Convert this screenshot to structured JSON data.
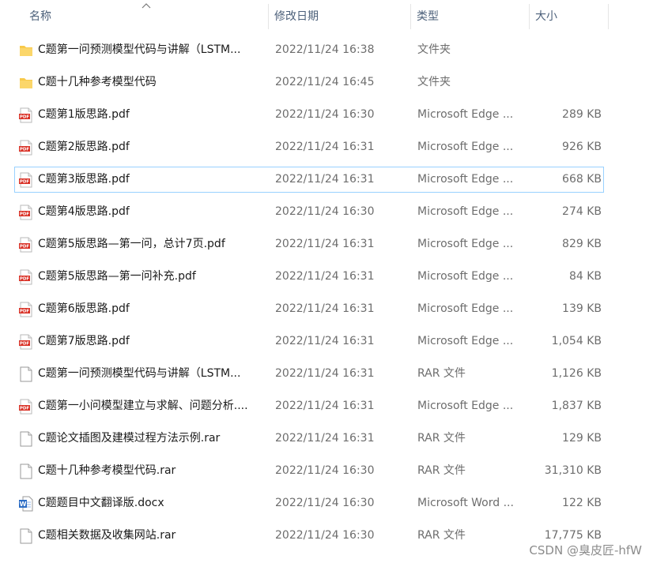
{
  "header": {
    "name_label": "名称",
    "date_label": "修改日期",
    "type_label": "类型",
    "size_label": "大小"
  },
  "files": [
    {
      "icon": "folder-icon",
      "name": "C题第一问预测模型代码与讲解（LSTM...",
      "date": "2022/11/24 16:38",
      "type": "文件夹",
      "size": ""
    },
    {
      "icon": "folder-icon",
      "name": "C题十几种参考模型代码",
      "date": "2022/11/24 16:45",
      "type": "文件夹",
      "size": ""
    },
    {
      "icon": "pdf-icon",
      "name": "C题第1版思路.pdf",
      "date": "2022/11/24 16:30",
      "type": "Microsoft Edge ...",
      "size": "289 KB"
    },
    {
      "icon": "pdf-icon",
      "name": "C题第2版思路.pdf",
      "date": "2022/11/24 16:31",
      "type": "Microsoft Edge ...",
      "size": "926 KB"
    },
    {
      "icon": "pdf-icon",
      "name": "C题第3版思路.pdf",
      "date": "2022/11/24 16:31",
      "type": "Microsoft Edge ...",
      "size": "668 KB"
    },
    {
      "icon": "pdf-icon",
      "name": "C题第4版思路.pdf",
      "date": "2022/11/24 16:30",
      "type": "Microsoft Edge ...",
      "size": "274 KB"
    },
    {
      "icon": "pdf-icon",
      "name": "C题第5版思路—第一问，总计7页.pdf",
      "date": "2022/11/24 16:31",
      "type": "Microsoft Edge ...",
      "size": "829 KB"
    },
    {
      "icon": "pdf-icon",
      "name": "C题第5版思路—第一问补充.pdf",
      "date": "2022/11/24 16:31",
      "type": "Microsoft Edge ...",
      "size": "84 KB"
    },
    {
      "icon": "pdf-icon",
      "name": "C题第6版思路.pdf",
      "date": "2022/11/24 16:31",
      "type": "Microsoft Edge ...",
      "size": "139 KB"
    },
    {
      "icon": "pdf-icon",
      "name": "C题第7版思路.pdf",
      "date": "2022/11/24 16:31",
      "type": "Microsoft Edge ...",
      "size": "1,054 KB"
    },
    {
      "icon": "file-icon",
      "name": "C题第一问预测模型代码与讲解（LSTM...",
      "date": "2022/11/24 16:31",
      "type": "RAR 文件",
      "size": "1,126 KB"
    },
    {
      "icon": "pdf-icon",
      "name": "C题第一小问模型建立与求解、问题分析....",
      "date": "2022/11/24 16:31",
      "type": "Microsoft Edge ...",
      "size": "1,837 KB"
    },
    {
      "icon": "file-icon",
      "name": "C题论文插图及建模过程方法示例.rar",
      "date": "2022/11/24 16:31",
      "type": "RAR 文件",
      "size": "129 KB"
    },
    {
      "icon": "file-icon",
      "name": "C题十几种参考模型代码.rar",
      "date": "2022/11/24 16:30",
      "type": "RAR 文件",
      "size": "31,310 KB"
    },
    {
      "icon": "word-icon",
      "name": "C题题目中文翻译版.docx",
      "date": "2022/11/24 16:30",
      "type": "Microsoft Word ...",
      "size": "122 KB"
    },
    {
      "icon": "file-icon",
      "name": "C题相关数据及收集网站.rar",
      "date": "2022/11/24 16:30",
      "type": "RAR 文件",
      "size": "17,775 KB"
    }
  ],
  "focused_row": 4,
  "watermark": "CSDN @臭皮匠-hfW",
  "colors": {
    "folder": "#f8c94a",
    "pdf": "#d93025",
    "word": "#2b6cc4",
    "focus_border": "#99d1ff",
    "header_text": "#4c607a"
  }
}
